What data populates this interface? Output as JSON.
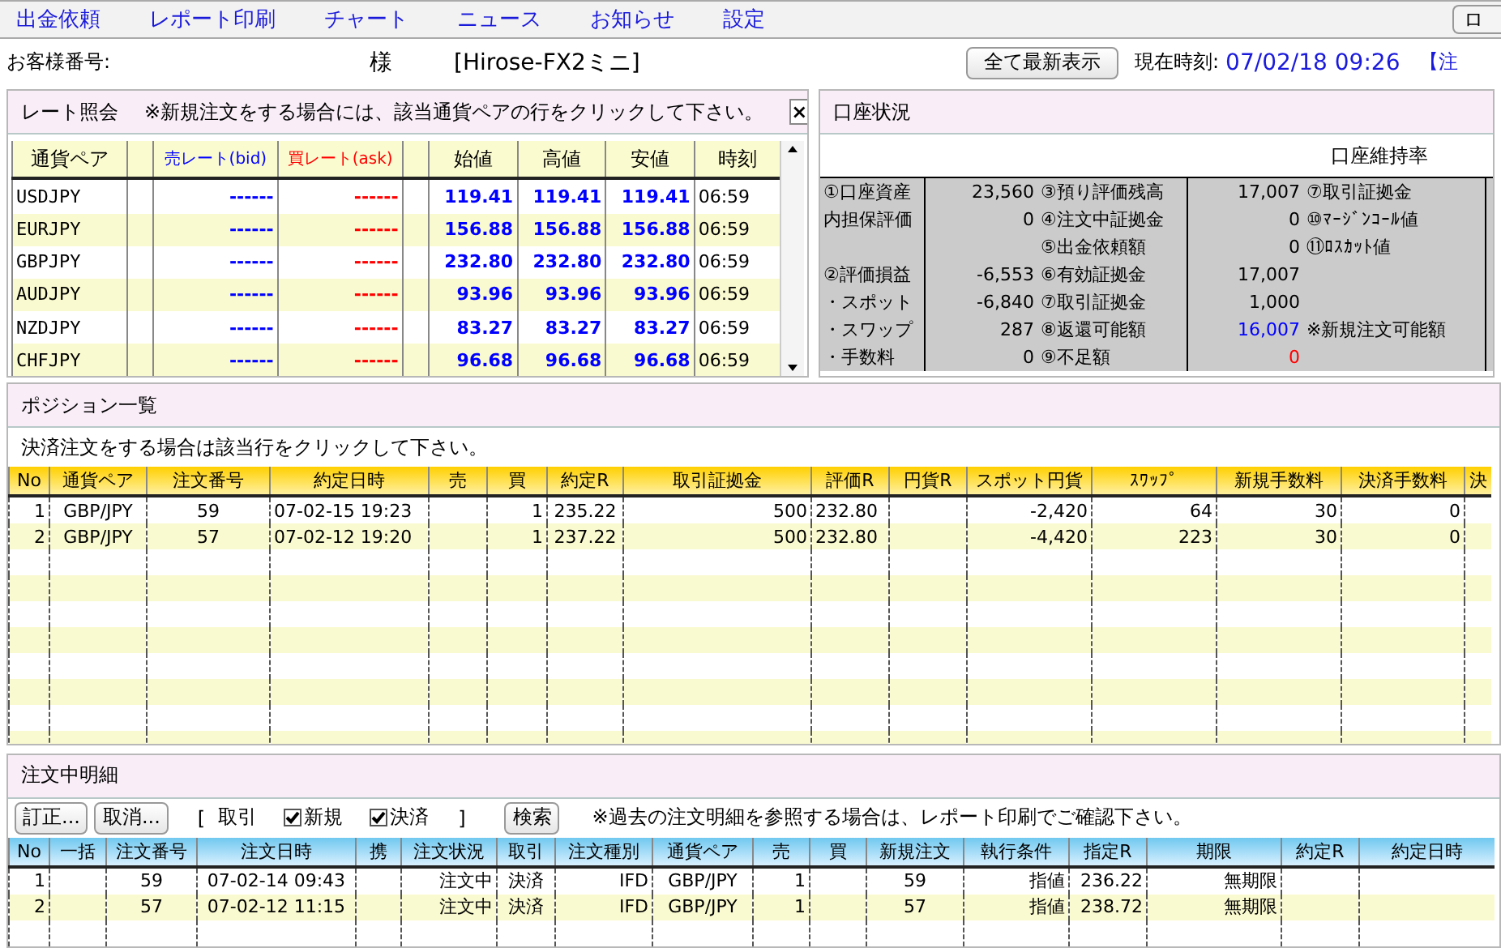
{
  "menu": {
    "items": [
      "出金依頼",
      "レポート印刷",
      "チャート",
      "ニュース",
      "お知らせ",
      "設定"
    ],
    "right_button": "ロ"
  },
  "header": {
    "customer_label": "お客様番号:",
    "honorific": "様",
    "product": "[Hirose-FX2ミニ]",
    "refresh_button": "全て最新表示",
    "time_label": "現在時刻:",
    "time_value": "07/02/18 09:26",
    "link": "【注"
  },
  "rate_panel": {
    "title": "レート照会",
    "note": "※新規注文をする場合には、該当通貨ペアの行をクリックして下さい。",
    "close": "×",
    "columns": [
      {
        "label": "通貨ペア"
      },
      {
        "label": "売レート(bid)",
        "color": "#0000ff"
      },
      {
        "label": "買レート(ask)",
        "color": "#ff0000"
      },
      {
        "label": "始値"
      },
      {
        "label": "高値"
      },
      {
        "label": "安値"
      },
      {
        "label": "時刻"
      }
    ],
    "rows": [
      {
        "pair": "USDJPY",
        "bid": "------",
        "ask": "------",
        "open": "119.41",
        "high": "119.41",
        "low": "119.41",
        "time": "06:59"
      },
      {
        "pair": "EURJPY",
        "bid": "------",
        "ask": "------",
        "open": "156.88",
        "high": "156.88",
        "low": "156.88",
        "time": "06:59"
      },
      {
        "pair": "GBPJPY",
        "bid": "------",
        "ask": "------",
        "open": "232.80",
        "high": "232.80",
        "low": "232.80",
        "time": "06:59"
      },
      {
        "pair": "AUDJPY",
        "bid": "------",
        "ask": "------",
        "open": "93.96",
        "high": "93.96",
        "low": "93.96",
        "time": "06:59"
      },
      {
        "pair": "NZDJPY",
        "bid": "------",
        "ask": "------",
        "open": "83.27",
        "high": "83.27",
        "low": "83.27",
        "time": "06:59"
      },
      {
        "pair": "CHFJPY",
        "bid": "------",
        "ask": "------",
        "open": "96.68",
        "high": "96.68",
        "low": "96.68",
        "time": "06:59"
      }
    ]
  },
  "account_panel": {
    "title": "口座状況",
    "header": "口座維持率",
    "rows": [
      {
        "left": {
          "label": "①口座資産",
          "value": "23,560"
        },
        "middle": {
          "label": "③預り評価残高",
          "value": "17,007"
        },
        "right": {
          "label": "⑦取引証拠金"
        }
      },
      {
        "left": {
          "label": "内担保評価",
          "value": "0"
        },
        "middle": {
          "label": "④注文中証拠金",
          "value": "0"
        },
        "right": {
          "label": "⑩ﾏｰｼﾞﾝｺｰﾙ値"
        }
      },
      {
        "middle": {
          "label": "⑤出金依頼額",
          "value": "0"
        },
        "right": {
          "label": "⑪ﾛｽｶｯﾄ値"
        }
      },
      {
        "left": {
          "label": "②評価損益",
          "value": "-6,553"
        },
        "middle": {
          "label": "⑥有効証拠金",
          "value": "17,007"
        }
      },
      {
        "left": {
          "label": "・スポット",
          "value": "-6,840"
        },
        "middle": {
          "label": "⑦取引証拠金",
          "value": "1,000"
        }
      },
      {
        "left": {
          "label": "・スワップ",
          "value": "287"
        },
        "middle": {
          "label": "⑧返還可能額",
          "value": "16,007",
          "color": "#0000ff"
        },
        "right": {
          "label": "※新規注文可能額"
        }
      },
      {
        "left": {
          "label": "・手数料",
          "value": "0"
        },
        "middle": {
          "label": "⑨不足額",
          "value": "0",
          "color": "#ff0000"
        }
      }
    ]
  },
  "positions_panel": {
    "title": "ポジション一覧",
    "note": "決済注文をする場合は該当行をクリックして下さい。",
    "columns": [
      "No",
      "通貨ペア",
      "注文番号",
      "約定日時",
      "売",
      "買",
      "約定R",
      "取引証拠金",
      "評価R",
      "円貨R",
      "スポット円貨",
      "ｽﾜｯﾌﾟ",
      "新規手数料",
      "決済手数料",
      "決"
    ],
    "rows": [
      [
        "1",
        "GBP/JPY",
        "59",
        "07-02-15 19:23",
        "",
        "1",
        "235.22",
        "500",
        "232.80",
        "",
        "-2,420",
        "64",
        "30",
        "0",
        ""
      ],
      [
        "2",
        "GBP/JPY",
        "57",
        "07-02-12 19:20",
        "",
        "1",
        "237.22",
        "500",
        "232.80",
        "",
        "-4,420",
        "223",
        "30",
        "0",
        ""
      ]
    ]
  },
  "orders_panel": {
    "title": "注文中明細",
    "buttons": [
      "訂正...",
      "取消..."
    ],
    "filter_open": "[",
    "filter_label": "取引",
    "checkboxes": [
      {
        "label": "新規",
        "checked": true
      },
      {
        "label": "決済",
        "checked": true
      }
    ],
    "filter_close": "]",
    "search_button": "検索",
    "note": "※過去の注文明細を参照する場合は、レポート印刷でご確認下さい。",
    "columns": [
      "No",
      "一括",
      "注文番号",
      "注文日時",
      "携",
      "注文状況",
      "取引",
      "注文種別",
      "通貨ペア",
      "売",
      "買",
      "新規注文",
      "執行条件",
      "指定R",
      "期限",
      "約定R",
      "約定日時"
    ],
    "rows": [
      [
        "1",
        "",
        "59",
        "07-02-14 09:43",
        "",
        "注文中",
        "決済",
        "IFD",
        "GBP/JPY",
        "1",
        "",
        "59",
        "指値",
        "236.22",
        "無期限",
        "",
        ""
      ],
      [
        "2",
        "",
        "57",
        "07-02-12 11:15",
        "",
        "注文中",
        "決済",
        "IFD",
        "GBP/JPY",
        "1",
        "",
        "57",
        "指値",
        "238.72",
        "無期限",
        "",
        ""
      ]
    ]
  }
}
